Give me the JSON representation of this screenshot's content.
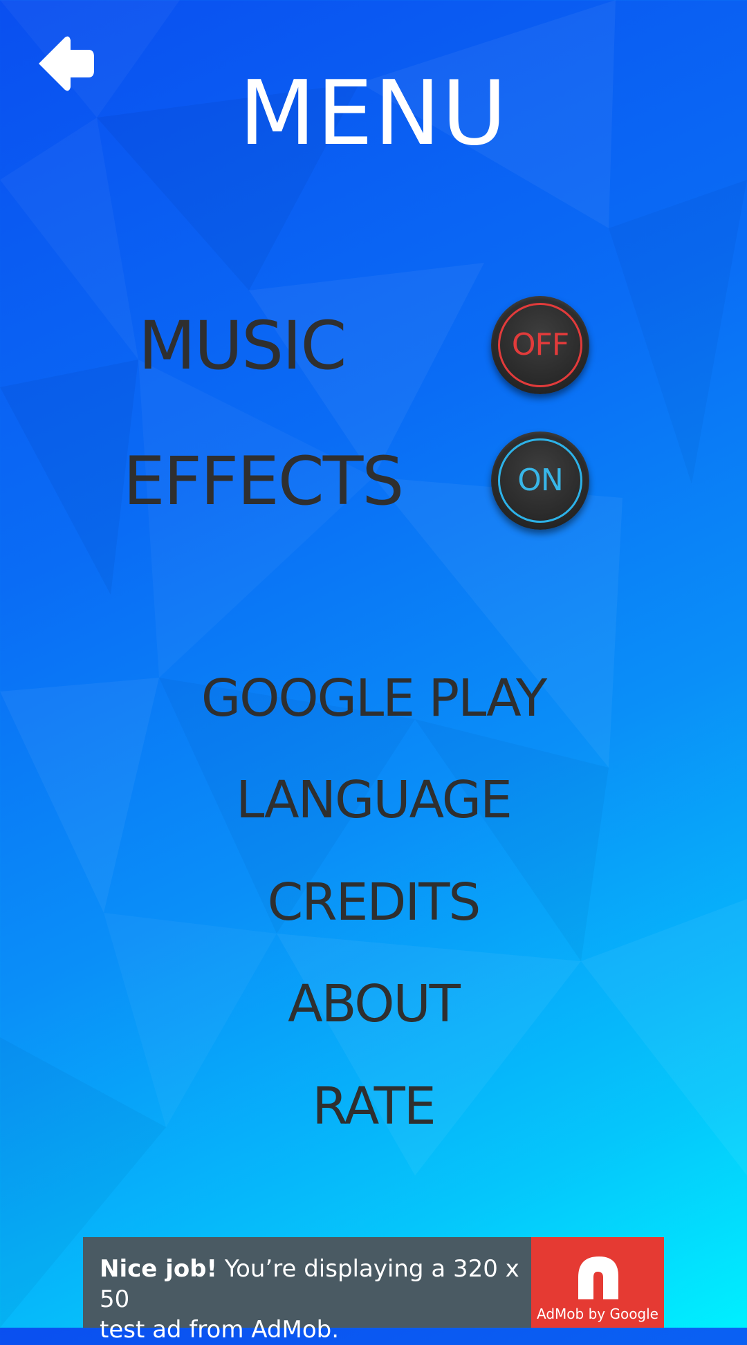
{
  "header": {
    "title": "MENU",
    "back_icon": "back-arrow-icon"
  },
  "settings": {
    "music": {
      "label": "MUSIC",
      "state": "OFF",
      "color": "#e23b3b"
    },
    "effects": {
      "label": "EFFECTS",
      "state": "ON",
      "color": "#2db2e8"
    }
  },
  "menu": {
    "items": [
      {
        "label": "GOOGLE PLAY"
      },
      {
        "label": "LANGUAGE"
      },
      {
        "label": "CREDITS"
      },
      {
        "label": "ABOUT"
      },
      {
        "label": "RATE"
      }
    ]
  },
  "ad": {
    "bold_text": "Nice job!",
    "body_line1": " You’re displaying a 320 x 50",
    "body_line2": "test ad from AdMob.",
    "logo_caption": "AdMob by Google",
    "bg_color": "#4a5a63",
    "logo_color": "#e53a33"
  },
  "colors": {
    "text_dark": "#2f2f2f",
    "background_start": "#0a4ff0",
    "background_end": "#00f0ff"
  }
}
